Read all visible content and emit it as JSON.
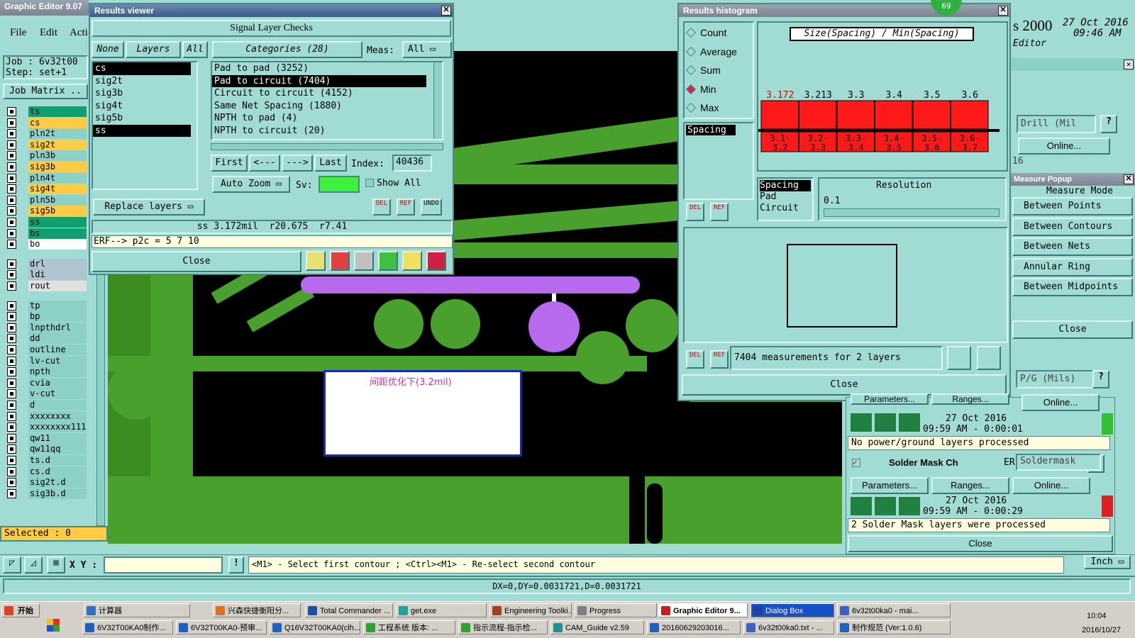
{
  "app": {
    "title": "Graphic Editor 9.07",
    "menu": [
      "File",
      "Edit",
      "Acti"
    ],
    "job_label": "Job : 6v32t00",
    "step_label": "Step: set+1",
    "job_matrix": "Job Matrix ..",
    "selected": "Selected : 0"
  },
  "layers": [
    "ts",
    "cs",
    "pln2t",
    "sig2t",
    "pln3b",
    "sig3b",
    "pln4t",
    "sig4t",
    "pln5b",
    "sig5b",
    "ss",
    "bs",
    "bo",
    "drl",
    "ldi",
    "rout",
    "tp",
    "bp",
    "lnpthdrl",
    "dd",
    "outline",
    "lv-cut",
    "npth",
    "cvia",
    "v-cut",
    "d",
    "xxxxxxxx",
    "xxxxxxxx111",
    "qw11",
    "qw11qq",
    "ts.d",
    "cs.d",
    "sig2t.d",
    "sig3b.d"
  ],
  "results": {
    "title": "Results viewer",
    "header": "Signal Layer Checks",
    "none": "None",
    "layers": "Layers",
    "all": "All",
    "categories": "Categories (28)",
    "meas": "Meas:",
    "meas_val": "All",
    "layer_list": [
      "cs",
      "sig2t",
      "sig3b",
      "sig4t",
      "sig5b",
      "ss"
    ],
    "cat_list": [
      "Pad to pad (3252)",
      "Pad to circuit (7404)",
      "Circuit to circuit (4152)",
      "Same Net Spacing (1880)",
      "NPTH to pad (4)",
      "NPTH to circuit (20)"
    ],
    "first": "First",
    "prev": "<---",
    "next": "--->",
    "last": "Last",
    "index_label": "Index:",
    "index_val": "40436",
    "auto_zoom": "Auto Zoom",
    "sv": "Sv:",
    "show_all": "Show All",
    "replace": "Replace layers",
    "del": "DEL",
    "ref": "REF",
    "undo": "UNDO",
    "status": "ss 3.172mil  r20.675  r7.41",
    "erf": "ERF--> p2c = 5 7 10",
    "close": "Close"
  },
  "histogram": {
    "title": "Results histogram",
    "badge": "69",
    "options": [
      "Count",
      "Average",
      "Sum",
      "Min",
      "Max"
    ],
    "selected_option": "Min",
    "chart_title": "Size(Spacing) / Min(Spacing)",
    "spacing_label": "Spacing",
    "list2": [
      "Spacing",
      "Pad",
      "Circuit"
    ],
    "resolution_label": "Resolution",
    "resolution_val": "0.1",
    "measure_text": "7404 measurements for 2 layers",
    "close": "Close"
  },
  "chart_data": {
    "type": "bar",
    "categories": [
      "3.1-3.2",
      "3.2-3.3",
      "3.3-3.4",
      "3.4-3.5",
      "3.5-3.6",
      "3.6-3.7"
    ],
    "values": [
      3.172,
      3.213,
      3.3,
      3.4,
      3.5,
      3.6
    ],
    "title": "Size(Spacing) / Min(Spacing)",
    "bar_color": "#ff1a1a"
  },
  "canvas": {
    "annotation": "间距优化下(3.2mil)"
  },
  "right": {
    "header_time": "27 Oct 2016",
    "header_time2": "09:46 AM",
    "header_big": "s 2000",
    "editor": "Editor",
    "drill": "Drill (Mil",
    "online": "Online...",
    "num16": "16",
    "measure_popup": "Measure Popup",
    "measure_mode": "Measure Mode",
    "modes": [
      "Between Points",
      "Between Contours",
      "Between Nets",
      "Annular Ring",
      "Between Midpoints"
    ],
    "close": "Close",
    "pg": "P/G (Mils)",
    "params": "Parameters...",
    "ranges": "Ranges...",
    "date1": "27 Oct 2016",
    "time1": "09:59 AM - 0:00:01",
    "msg1": "No power/ground layers processed",
    "solder": "Solder Mask Ch",
    "erf": "ERF:",
    "soldermask": "Soldermask",
    "date2": "27 Oct 2016",
    "time2": "09:59 AM - 0:00:29",
    "msg2": "2 Solder Mask layers were processed",
    "close2": "Close",
    "inch": "Inch"
  },
  "bottom": {
    "xy": "X Y :",
    "prompt": "<M1> - Select first contour ; <Ctrl><M1> - Re-select second contour",
    "dx": "DX=0,DY=0.0031721,D=0.0031721"
  },
  "taskbar": {
    "start": "开始",
    "row1": [
      "计算器",
      "兴森快捷衡阳分...",
      "Total Commander ...",
      "get.exe",
      "Engineering Toolki...",
      "Progress",
      "Graphic Editor 9...",
      "Dialog Box",
      "6v32t00ka0 - mai..."
    ],
    "row2": [
      "6V32T00KA0制作...",
      "6V32T00KA0-预审...",
      "Q16V32T00KA0(clh...",
      "工程系统  版本: ...",
      "指示流程-指示检...",
      "CAM_Guide v2.59",
      "20160629203016...",
      "6v32t00ka0.txt - ...",
      "制作规范 (Ver:1.0.6)"
    ],
    "time": "10:04",
    "date": "2016/10/27"
  }
}
